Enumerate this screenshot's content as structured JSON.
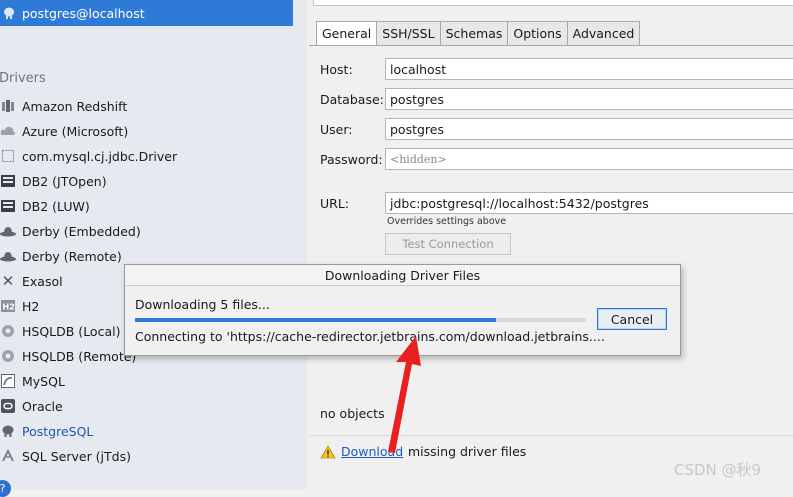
{
  "sidebar": {
    "selected_datasource": "postgres@localhost",
    "drivers_heading": "Drivers",
    "drivers": [
      {
        "label": "Amazon Redshift",
        "icon": "redshift-icon"
      },
      {
        "label": "Azure (Microsoft)",
        "icon": "cloud-icon"
      },
      {
        "label": "com.mysql.cj.jdbc.Driver",
        "icon": "generic-driver-icon"
      },
      {
        "label": "DB2 (JTOpen)",
        "icon": "db2-icon"
      },
      {
        "label": "DB2 (LUW)",
        "icon": "db2-icon"
      },
      {
        "label": "Derby (Embedded)",
        "icon": "derby-hat-icon"
      },
      {
        "label": "Derby (Remote)",
        "icon": "derby-hat-icon"
      },
      {
        "label": "Exasol",
        "icon": "exasol-x-icon"
      },
      {
        "label": "H2",
        "icon": "h2-icon"
      },
      {
        "label": "HSQLDB (Local)",
        "icon": "hsqldb-icon"
      },
      {
        "label": "HSQLDB (Remote)",
        "icon": "hsqldb-icon"
      },
      {
        "label": "MySQL",
        "icon": "mysql-dolphin-icon"
      },
      {
        "label": "Oracle",
        "icon": "oracle-icon"
      },
      {
        "label": "PostgreSQL",
        "icon": "postgresql-elephant-icon"
      },
      {
        "label": "SQL Server (jTds)",
        "icon": "sqlserver-icon"
      }
    ],
    "help_badge": "?"
  },
  "tabs": [
    "General",
    "SSH/SSL",
    "Schemas",
    "Options",
    "Advanced"
  ],
  "form": {
    "host_label": "Host:",
    "host_value": "localhost",
    "database_label": "Database:",
    "database_value": "postgres",
    "user_label": "User:",
    "user_value": "postgres",
    "password_label": "Password:",
    "password_value": "<hidden>",
    "url_label": "URL:",
    "url_value": "jdbc:postgresql://localhost:5432/postgres",
    "url_hint": "Overrides settings above",
    "test_button": "Test Connection"
  },
  "dialog": {
    "title": "Downloading Driver Files",
    "count_text": "Downloading 5 files...",
    "status_text": "Connecting to 'https://cache-redirector.jetbrains.com/download.jetbrains....",
    "progress_percent": 80,
    "cancel_label": "Cancel"
  },
  "status": {
    "no_objects": "no objects",
    "download_link": "Download",
    "missing_text": "missing driver files"
  },
  "watermark": "CSDN @秋9",
  "colors": {
    "selection_blue": "#2f7ad6",
    "link_blue": "#1e5bc6",
    "annotation_arrow": "#e8211f"
  }
}
